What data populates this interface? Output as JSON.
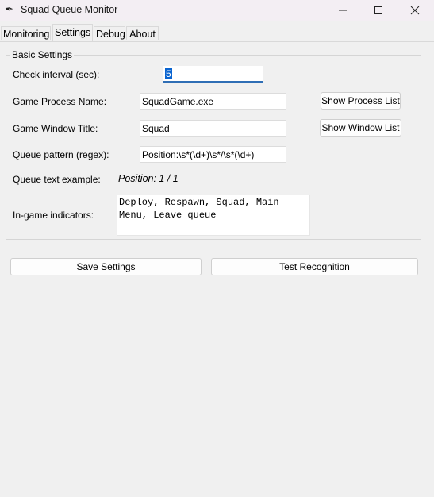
{
  "window": {
    "title": "Squad Queue Monitor",
    "app_icon": "feather-icon"
  },
  "tabs": [
    {
      "label": "Monitoring",
      "selected": false
    },
    {
      "label": "Settings",
      "selected": true
    },
    {
      "label": "Debug",
      "selected": false
    },
    {
      "label": "About",
      "selected": false
    }
  ],
  "basic_settings": {
    "group_label": "Basic Settings",
    "check_interval": {
      "label": "Check interval (sec):",
      "value": "5"
    },
    "process_name": {
      "label": "Game Process Name:",
      "value": "SquadGame.exe",
      "button": "Show Process List"
    },
    "window_title": {
      "label": "Game Window Title:",
      "value": "Squad",
      "button": "Show Window List"
    },
    "queue_pattern": {
      "label": "Queue pattern (regex):",
      "value": "Position:\\s*(\\d+)\\s*/\\s*(\\d+)"
    },
    "queue_example": {
      "label": "Queue text example:",
      "value": "Position: 1 / 1"
    },
    "indicators": {
      "label": "In-game indicators:",
      "value": "Deploy, Respawn, Squad, Main Menu, Leave queue"
    }
  },
  "actions": {
    "save": "Save Settings",
    "test": "Test Recognition"
  },
  "colors": {
    "focus_underline": "#2f6eb5",
    "selection": "#0a64d0",
    "background": "#f0f0f0"
  }
}
